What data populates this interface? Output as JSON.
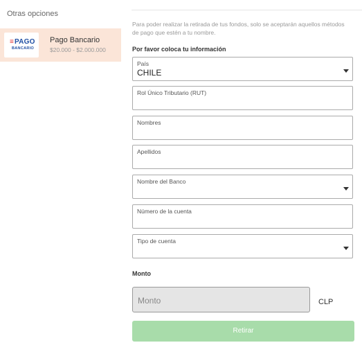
{
  "sidebar": {
    "title": "Otras opciones",
    "payment_method": {
      "logo_main": "PAGO",
      "logo_sub": "BANCARIO",
      "name": "Pago Bancario",
      "range": "$20.000 - $2.000.000"
    }
  },
  "notice": "Para poder realizar la retirada de tus fondos, solo se aceptarán aquellos métodos de pago que estén a tu nombre.",
  "info_section": {
    "label": "Por favor coloca tu información"
  },
  "fields": [
    {
      "label": "País",
      "value": "CHILE",
      "type": "select"
    },
    {
      "label": "Rol Único Tributario (RUT)",
      "value": "",
      "type": "text"
    },
    {
      "label": "Nombres",
      "value": "",
      "type": "text"
    },
    {
      "label": "Apellidos",
      "value": "",
      "type": "text"
    },
    {
      "label": "Nombre del Banco",
      "value": "",
      "type": "select"
    },
    {
      "label": "Número de la cuenta",
      "value": "",
      "type": "text"
    },
    {
      "label": "Tipo de cuenta",
      "value": "",
      "type": "select"
    }
  ],
  "amount": {
    "label": "Monto",
    "placeholder": "Monto",
    "currency": "CLP"
  },
  "submit": {
    "label": "Retirar",
    "color": "#a8dcaa"
  },
  "colors": {
    "selected_card": "#fbe5d8",
    "logo_blue": "#1f4fa3",
    "logo_red": "#e03030"
  },
  "icons": {
    "dropdown": "caret-down-icon"
  }
}
